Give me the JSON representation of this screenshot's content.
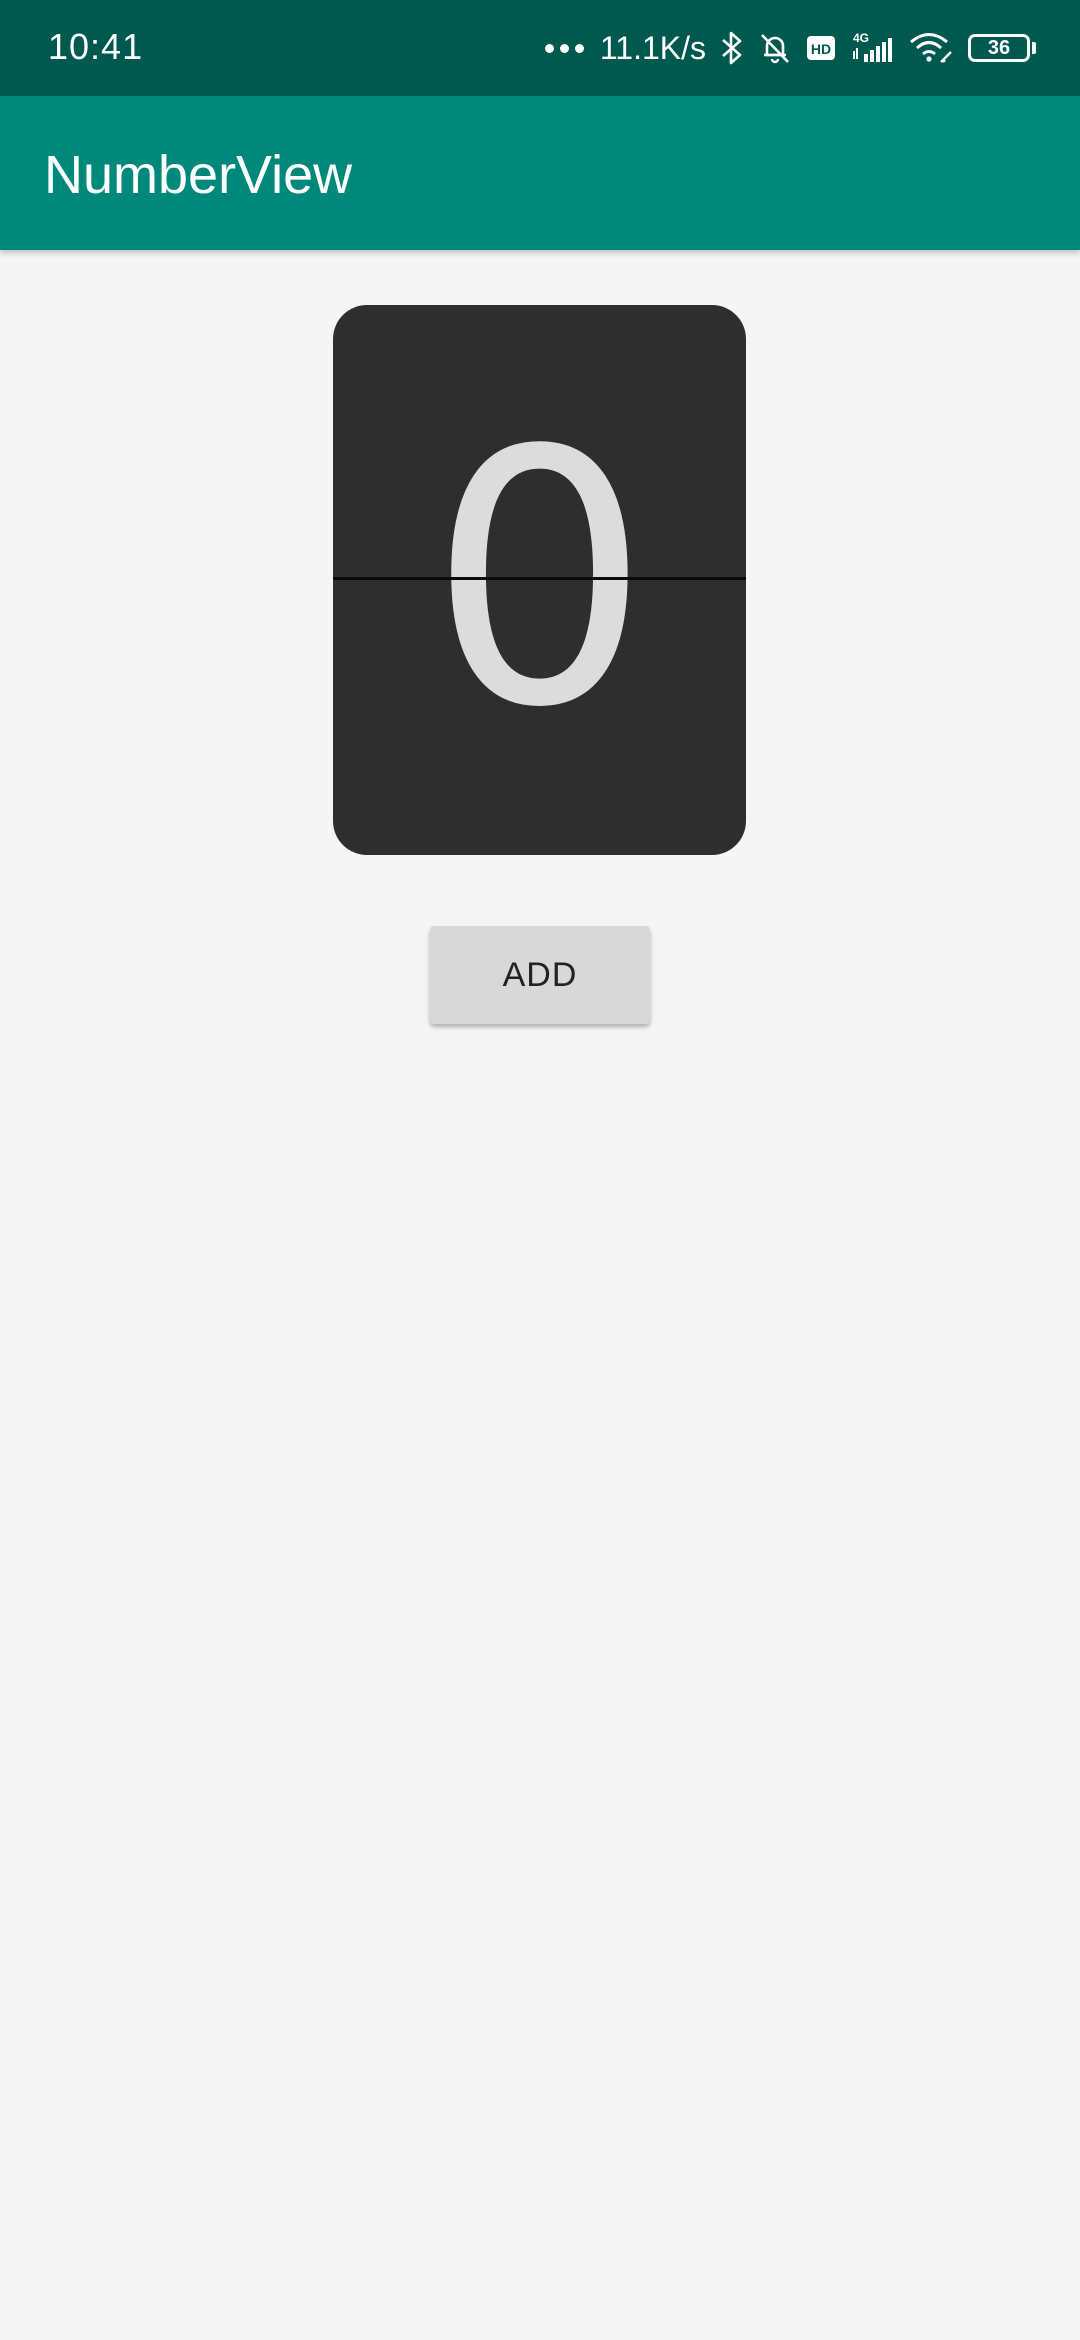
{
  "status_bar": {
    "time": "10:41",
    "net_speed": "11.1K/s",
    "network": "4G",
    "hd_badge": "HD",
    "battery": "36",
    "icons": [
      "dots-icon",
      "bluetooth-icon",
      "bell-off-icon",
      "hd-icon",
      "signal-4g-icon",
      "wifi-icon",
      "battery-icon"
    ]
  },
  "app_bar": {
    "title": "NumberView"
  },
  "number_view": {
    "value": "0"
  },
  "add_button": {
    "label": "ADD"
  },
  "colors": {
    "status_bar": "#00594f",
    "app_bar": "#00897b",
    "card": "#2e2e2e",
    "digit": "#dcdcdc",
    "background": "#f5f5f5",
    "button": "#d8d8d8"
  }
}
